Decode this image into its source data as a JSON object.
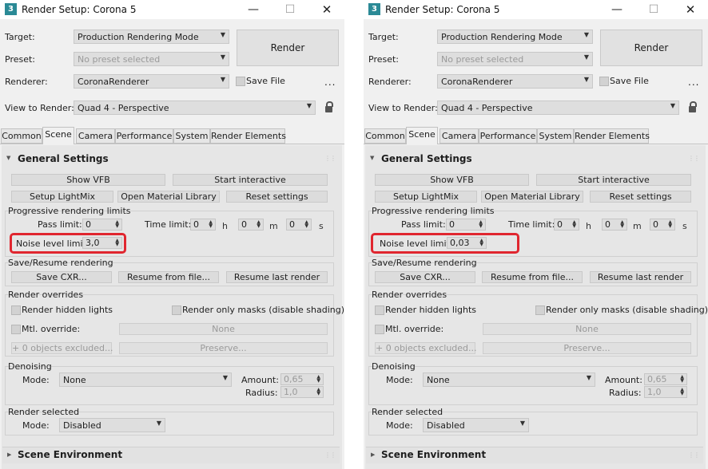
{
  "panels": [
    {
      "title": "Render Setup: Corona 5",
      "app_icon_glyph": "3",
      "labels": {
        "target": "Target:",
        "preset": "Preset:",
        "renderer": "Renderer:",
        "view_to_render": "View to Render:"
      },
      "target_value": "Production Rendering Mode",
      "preset_value": "No preset selected",
      "renderer_value": "CoronaRenderer",
      "view_value": "Quad 4 - Perspective",
      "render_button": "Render",
      "save_file_label": "Save File",
      "more_label": "...",
      "tabs": [
        "Common",
        "Scene",
        "Camera",
        "Performance",
        "System",
        "Render Elements"
      ],
      "active_tab": "Scene",
      "general_settings": {
        "title": "General Settings",
        "show_vfb": "Show VFB",
        "start_interactive": "Start interactive",
        "setup_lightmix": "Setup LightMix",
        "open_material_library": "Open Material Library",
        "reset_settings": "Reset settings",
        "progressive_title": "Progressive rendering limits",
        "pass_limit_label": "Pass limit:",
        "pass_limit_value": "0",
        "time_limit_label": "Time limit:",
        "time_h": "0",
        "unit_h": "h",
        "time_m": "0",
        "unit_m": "m",
        "time_s": "0",
        "unit_s": "s",
        "noise_label": "Noise level limit:",
        "noise_value": "3,0",
        "save_resume_title": "Save/Resume rendering",
        "save_cxr": "Save CXR...",
        "resume_from_file": "Resume from file...",
        "resume_last_render": "Resume last render",
        "overrides_title": "Render overrides",
        "render_hidden_lights": "Render hidden lights",
        "render_only_masks": "Render only masks (disable shading)",
        "mtl_override": "Mtl. override:",
        "none_button": "None",
        "objects_excluded": "0 objects excluded...",
        "preserve": "Preserve...",
        "denoising_title": "Denoising",
        "mode_label": "Mode:",
        "mode_value": "None",
        "amount_label": "Amount:",
        "amount_value": "0,65",
        "radius_label": "Radius:",
        "radius_value": "1,0",
        "render_selected_title": "Render selected",
        "render_selected_mode_label": "Mode:",
        "render_selected_mode_value": "Disabled"
      },
      "scene_environment": "Scene Environment"
    },
    {
      "title": "Render Setup: Corona 5",
      "app_icon_glyph": "3",
      "labels": {
        "target": "Target:",
        "preset": "Preset:",
        "renderer": "Renderer:",
        "view_to_render": "View to Render:"
      },
      "target_value": "Production Rendering Mode",
      "preset_value": "No preset selected",
      "renderer_value": "CoronaRenderer",
      "view_value": "Quad 4 - Perspective",
      "render_button": "Render",
      "save_file_label": "Save File",
      "more_label": "...",
      "tabs": [
        "Common",
        "Scene",
        "Camera",
        "Performance",
        "System",
        "Render Elements"
      ],
      "active_tab": "Scene",
      "general_settings": {
        "title": "General Settings",
        "show_vfb": "Show VFB",
        "start_interactive": "Start interactive",
        "setup_lightmix": "Setup LightMix",
        "open_material_library": "Open Material Library",
        "reset_settings": "Reset settings",
        "progressive_title": "Progressive rendering limits",
        "pass_limit_label": "Pass limit:",
        "pass_limit_value": "0",
        "time_limit_label": "Time limit:",
        "time_h": "0",
        "unit_h": "h",
        "time_m": "0",
        "unit_m": "m",
        "time_s": "0",
        "unit_s": "s",
        "noise_label": "Noise level limit:",
        "noise_value": "0,03",
        "save_resume_title": "Save/Resume rendering",
        "save_cxr": "Save CXR...",
        "resume_from_file": "Resume from file...",
        "resume_last_render": "Resume last render",
        "overrides_title": "Render overrides",
        "render_hidden_lights": "Render hidden lights",
        "render_only_masks": "Render only masks (disable shading)",
        "mtl_override": "Mtl. override:",
        "none_button": "None",
        "objects_excluded": "0 objects excluded...",
        "preserve": "Preserve...",
        "denoising_title": "Denoising",
        "mode_label": "Mode:",
        "mode_value": "None",
        "amount_label": "Amount:",
        "amount_value": "0,65",
        "radius_label": "Radius:",
        "radius_value": "1,0",
        "render_selected_title": "Render selected",
        "render_selected_mode_label": "Mode:",
        "render_selected_mode_value": "Disabled"
      },
      "scene_environment": "Scene Environment"
    }
  ],
  "colors": {
    "highlight": "#e0262f",
    "app_icon": "#2b8a96"
  },
  "icons": {
    "minimize": "minimize-icon",
    "maximize": "maximize-icon",
    "close": "close-icon",
    "lock": "lock-icon",
    "dropdown": "chevron-down-icon"
  }
}
